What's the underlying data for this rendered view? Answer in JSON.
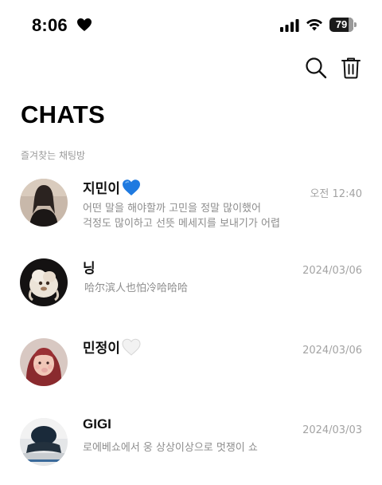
{
  "status_bar": {
    "time": "8:06",
    "battery_percent": "79",
    "battery_level": 0.79
  },
  "toolbar": {
    "search_icon": "search-icon",
    "trash_icon": "trash-icon"
  },
  "page": {
    "title": "CHATS",
    "favorites_label": "즐겨찾는 채팅방"
  },
  "chats": [
    {
      "name": "지민이",
      "name_icon": "blue-heart-icon",
      "time": "오전 12:40",
      "preview": "어떤 말을 해야할까 고민을 정말 많이했어\n걱정도 많이하고 선뜻 메세지를 보내기가 어렵",
      "avatar_colors": [
        "#2b2320",
        "#c99b86",
        "#5a4236"
      ]
    },
    {
      "name": "닝",
      "name_icon": "",
      "time": "2024/03/06",
      "preview": "哈尔滨人也怕冷哈哈哈",
      "avatar_colors": [
        "#1c1a1a",
        "#ece4d8",
        "#a07a5e"
      ]
    },
    {
      "name": "민정이",
      "name_icon": "white-heart-icon",
      "time": "2024/03/06",
      "preview": "",
      "avatar_colors": [
        "#8a2a2e",
        "#f1c7b8",
        "#e7aaa5"
      ]
    },
    {
      "name": "GIGI",
      "name_icon": "",
      "time": "2024/03/03",
      "preview": "로에베쇼에서 웅 상상이상으로 멋쟁이 쇼",
      "avatar_colors": [
        "#1a2a3a",
        "#c8ccd0",
        "#f2f2f2"
      ]
    }
  ],
  "colors": {
    "background": "#ffffff",
    "title": "#000000",
    "secondary_text": "#8d8d8d",
    "blue_heart": "#1f7ae0",
    "white_heart": "#f2f2f2"
  }
}
